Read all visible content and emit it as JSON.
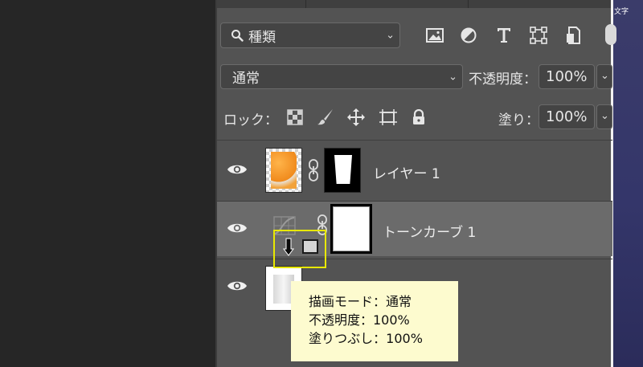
{
  "window": {
    "corner_text": "文字"
  },
  "filter": {
    "icon": "search-icon",
    "label": "種類"
  },
  "filter_icons": [
    "image-filter-icon",
    "adjustment-filter-icon",
    "type-filter-icon",
    "shape-filter-icon",
    "smart-object-filter-icon"
  ],
  "blend": {
    "mode": "通常",
    "opacity_label": "不透明度：",
    "opacity_value": "100%"
  },
  "lock": {
    "label": "ロック：",
    "fill_label": "塗り：",
    "fill_value": "100%"
  },
  "layers": [
    {
      "name": "レイヤー 1",
      "visible": true,
      "selected": false
    },
    {
      "name": "トーンカーブ 1",
      "visible": true,
      "selected": true
    },
    {
      "name": "",
      "visible": true,
      "selected": false
    }
  ],
  "tooltip": {
    "line1": "描画モード：通常",
    "line2": "不透明度：100%",
    "line3": "塗りつぶし：100%"
  },
  "colors": {
    "panel": "#535353",
    "highlight": "#e8e800",
    "tooltip_bg": "#fdfbcf"
  }
}
